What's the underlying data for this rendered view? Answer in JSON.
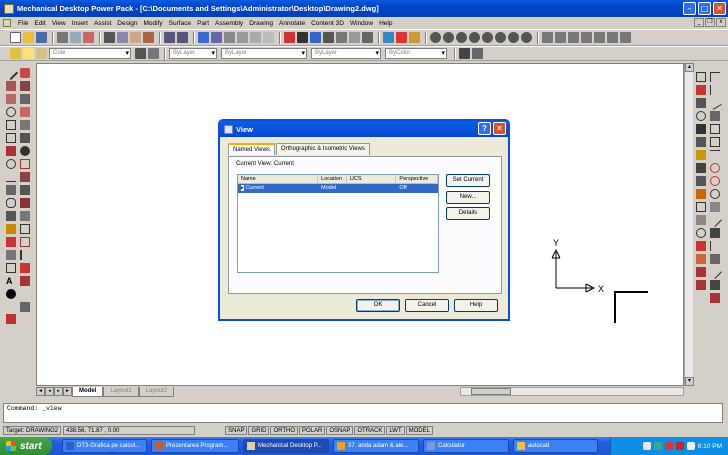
{
  "window": {
    "title": "Mechanical Desktop Power Pack - [C:\\Documents and Settings\\Administrator\\Desktop\\Drawing2.dwg]"
  },
  "menu": [
    "File",
    "Edit",
    "View",
    "Insert",
    "Assist",
    "Design",
    "Modify",
    "Surface",
    "Part",
    "Assembly",
    "Drawing",
    "Annotate",
    "Content 3D",
    "Window",
    "Help"
  ],
  "toolbar2": {
    "layer_value": "Cole",
    "color_value": "ByLayer",
    "linetype_value": "ByLayer",
    "lineweight_value": "ByLayer",
    "plotstyle_value": "ByColor"
  },
  "layout_tabs": [
    "Model",
    "Layout1",
    "Layout2"
  ],
  "command": {
    "prompt": "Command: _view"
  },
  "status": {
    "target": "Target: DRAWING2",
    "coords": "438.56, 71.87 , 0.00",
    "toggles": [
      "SNAP",
      "GRID",
      "ORTHO",
      "POLAR",
      "OSNAP",
      "OTRACK",
      "LWT",
      "MODEL"
    ]
  },
  "ucs": {
    "x_label": "X",
    "y_label": "Y"
  },
  "dialog": {
    "title": "View",
    "tabs": [
      "Named Views",
      "Orthographic & Isometric Views"
    ],
    "current_view_label": "Current View:",
    "current_view_value": "Current",
    "columns": [
      "Name",
      "Location",
      "UCS",
      "Perspective"
    ],
    "rows": [
      {
        "name": "Current",
        "location": "Model",
        "ucs": "",
        "perspective": "Off"
      }
    ],
    "buttons": {
      "set_current": "Set Current",
      "new": "New...",
      "details": "Details",
      "ok": "OK",
      "cancel": "Cancel",
      "help": "Help"
    }
  },
  "taskbar": {
    "start": "start",
    "items": [
      "DT3-Grafica pe calcul...",
      "Prezentarea Program...",
      "Mechanical Desktop P...",
      "37. anda adam & ale...",
      "Calculator",
      "autocad"
    ],
    "active_index": 2,
    "clock": "6:10 PM"
  }
}
